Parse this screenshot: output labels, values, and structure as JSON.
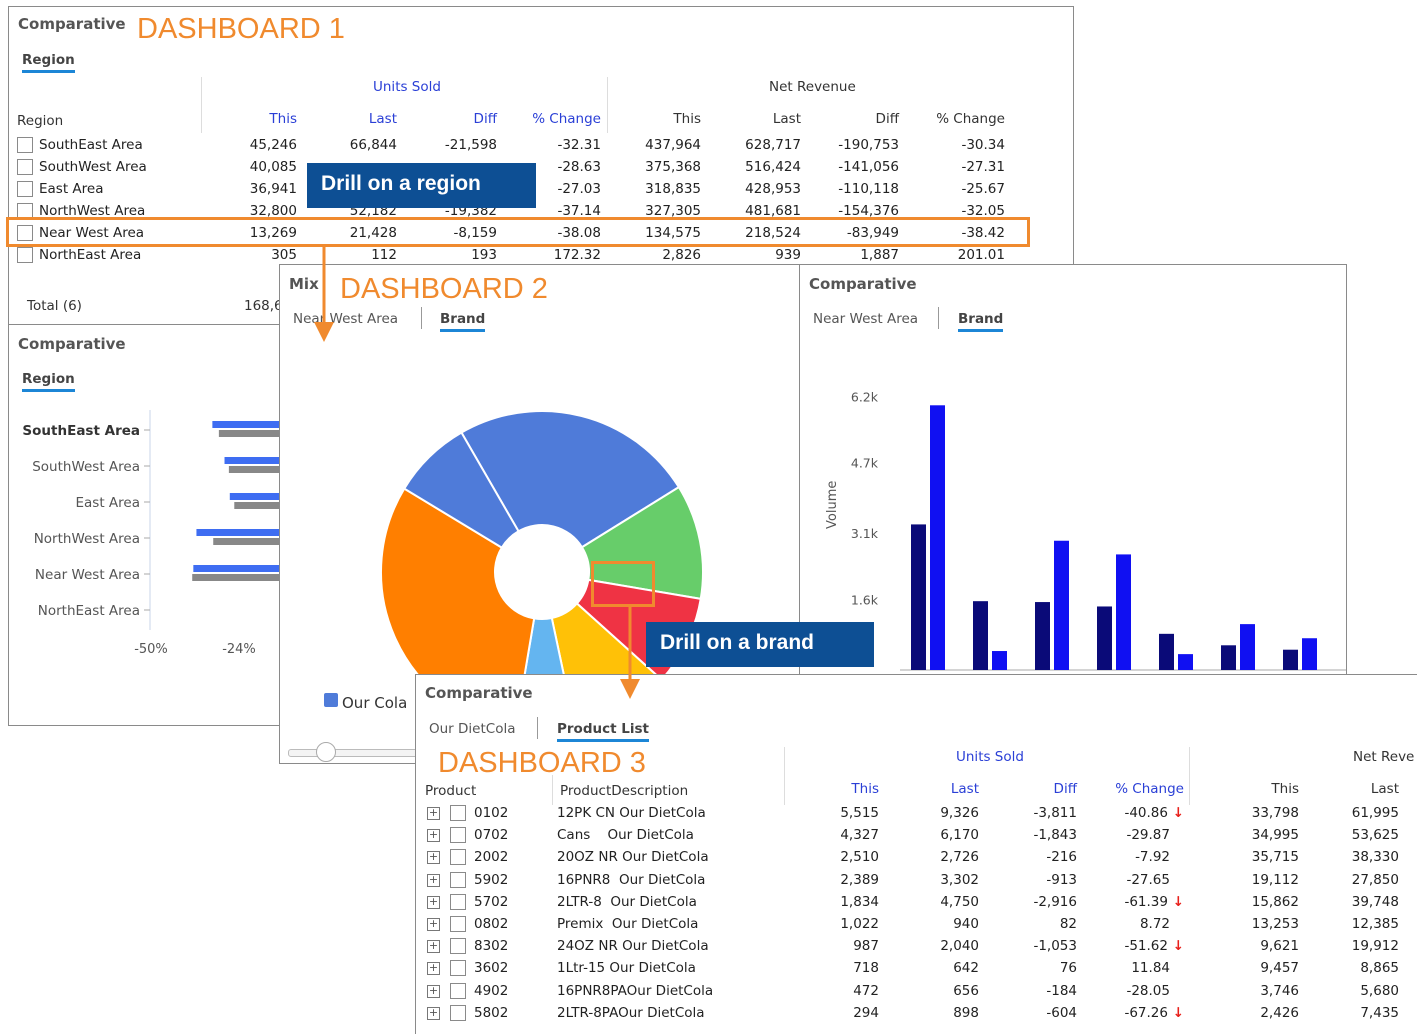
{
  "dashboard1": {
    "title": "Comparative",
    "tag": "DASHBOARD 1",
    "tab": "Region",
    "group_units": "Units Sold",
    "group_revenue": "Net Revenue",
    "col_region": "Region",
    "cols_units": [
      "This",
      "Last",
      "Diff",
      "% Change"
    ],
    "cols_revenue": [
      "This",
      "Last",
      "Diff",
      "% Change"
    ],
    "rows": [
      {
        "name": "SouthEast Area",
        "u": [
          "45,246",
          "66,844",
          "-21,598",
          "-32.31"
        ],
        "r": [
          "437,964",
          "628,717",
          "-190,753",
          "-30.34"
        ]
      },
      {
        "name": "SouthWest Area",
        "u": [
          "40,085",
          "",
          "",
          "-28.63"
        ],
        "r": [
          "375,368",
          "516,424",
          "-141,056",
          "-27.31"
        ]
      },
      {
        "name": "East Area",
        "u": [
          "36,941",
          "",
          "",
          "-27.03"
        ],
        "r": [
          "318,835",
          "428,953",
          "-110,118",
          "-25.67"
        ]
      },
      {
        "name": "NorthWest Area",
        "u": [
          "32,800",
          "52,182",
          "-19,382",
          "-37.14"
        ],
        "r": [
          "327,305",
          "481,681",
          "-154,376",
          "-32.05"
        ]
      },
      {
        "name": "Near West Area",
        "u": [
          "13,269",
          "21,428",
          "-8,159",
          "-38.08"
        ],
        "r": [
          "134,575",
          "218,524",
          "-83,949",
          "-38.42"
        ]
      },
      {
        "name": "NorthEast Area",
        "u": [
          "305",
          "112",
          "193",
          "172.32"
        ],
        "r": [
          "2,826",
          "939",
          "1,887",
          "201.01"
        ]
      }
    ],
    "total_label": "Total (6)",
    "total_value": "168,6"
  },
  "callouts": {
    "region": "Drill on a region",
    "brand": "Drill on a brand"
  },
  "comp_region_chart": {
    "title": "Comparative",
    "tab": "Region",
    "categories": [
      "SouthEast Area",
      "SouthWest Area",
      "East Area",
      "NorthWest Area",
      "Near West Area",
      "NorthEast Area"
    ],
    "ticks": [
      "-50%",
      "-24%"
    ]
  },
  "dashboard2": {
    "mix_title": "Mix",
    "tag": "DASHBOARD 2",
    "breadcrumb": "Near West Area",
    "tab": "Brand",
    "legend_label": "Our Cola"
  },
  "brand_chart": {
    "title": "Comparative",
    "breadcrumb": "Near West Area",
    "tab": "Brand",
    "ylabel": "Volume"
  },
  "chart_data": [
    {
      "type": "pie",
      "title": "",
      "labels": [
        "",
        "",
        "",
        "",
        "",
        "",
        ""
      ],
      "values": [
        24.5,
        11.5,
        9,
        10,
        6,
        31,
        8
      ],
      "colors": [
        "#4f7bd9",
        "#67cd6a",
        "#ef3344",
        "#ffc107",
        "#64b5f0",
        "#ff7f00",
        "#4f7bd9"
      ]
    },
    {
      "type": "bar",
      "title": "",
      "ylabel": "Volume",
      "yticks": [
        "1.6k",
        "3.1k",
        "4.7k",
        "6.2k"
      ],
      "ylim": [
        0,
        6800
      ],
      "categories": [
        "",
        "",
        "",
        "",
        "",
        "",
        ""
      ],
      "series": [
        {
          "values": [
            3300,
            1560,
            1540,
            1440,
            820,
            560,
            460
          ],
          "color": "#0a0a78"
        },
        {
          "values": [
            6000,
            430,
            2930,
            2620,
            360,
            1040,
            720
          ],
          "color": "#1010f2"
        }
      ]
    },
    {
      "type": "bar",
      "title": "",
      "orientation": "horizontal",
      "categories": [
        "SouthEast Area",
        "SouthWest Area",
        "East Area",
        "NorthWest Area",
        "Near West Area",
        "NorthEast Area"
      ],
      "series": [
        {
          "values": [
            -32.31,
            -28.63,
            -27.03,
            -37.14,
            -38.08,
            0
          ],
          "color": "#3e6df2"
        },
        {
          "values": [
            -30.34,
            -27.31,
            -25.67,
            -32.05,
            -38.42,
            0
          ],
          "color": "#888888"
        }
      ],
      "xticks": [
        "-50%",
        "-24%"
      ]
    }
  ],
  "dashboard3": {
    "title": "Comparative",
    "tag": "DASHBOARD 3",
    "breadcrumb": "Our DietCola",
    "tab": "Product List",
    "group_units": "Units Sold",
    "group_revenue": "Net Reve",
    "col_product": "Product",
    "col_desc": "ProductDescription",
    "cols_units": [
      "This",
      "Last",
      "Diff",
      "% Change"
    ],
    "cols_revenue": [
      "This",
      "Last"
    ],
    "rows": [
      {
        "code": "0102",
        "desc": "12PK CN Our DietCola",
        "u": [
          "5,515",
          "9,326",
          "-3,811",
          "-40.86"
        ],
        "down": true,
        "r": [
          "33,798",
          "61,995"
        ]
      },
      {
        "code": "0702",
        "desc": "Cans    Our DietCola",
        "u": [
          "4,327",
          "6,170",
          "-1,843",
          "-29.87"
        ],
        "down": false,
        "r": [
          "34,995",
          "53,625"
        ]
      },
      {
        "code": "2002",
        "desc": "20OZ NR Our DietCola",
        "u": [
          "2,510",
          "2,726",
          "-216",
          "-7.92"
        ],
        "down": false,
        "r": [
          "35,715",
          "38,330"
        ]
      },
      {
        "code": "5902",
        "desc": "16PNR8  Our DietCola",
        "u": [
          "2,389",
          "3,302",
          "-913",
          "-27.65"
        ],
        "down": false,
        "r": [
          "19,112",
          "27,850"
        ]
      },
      {
        "code": "5702",
        "desc": "2LTR-8  Our DietCola",
        "u": [
          "1,834",
          "4,750",
          "-2,916",
          "-61.39"
        ],
        "down": true,
        "r": [
          "15,862",
          "39,748"
        ]
      },
      {
        "code": "0802",
        "desc": "Premix  Our DietCola",
        "u": [
          "1,022",
          "940",
          "82",
          "8.72"
        ],
        "down": false,
        "r": [
          "13,253",
          "12,385"
        ]
      },
      {
        "code": "8302",
        "desc": "24OZ NR Our DietCola",
        "u": [
          "987",
          "2,040",
          "-1,053",
          "-51.62"
        ],
        "down": true,
        "r": [
          "9,621",
          "19,912"
        ]
      },
      {
        "code": "3602",
        "desc": "1Ltr-15 Our DietCola",
        "u": [
          "718",
          "642",
          "76",
          "11.84"
        ],
        "down": false,
        "r": [
          "9,457",
          "8,865"
        ]
      },
      {
        "code": "4902",
        "desc": "16PNR8PAOur DietCola",
        "u": [
          "472",
          "656",
          "-184",
          "-28.05"
        ],
        "down": false,
        "r": [
          "3,746",
          "5,680"
        ]
      },
      {
        "code": "5802",
        "desc": "2LTR-8PAOur DietCola",
        "u": [
          "294",
          "898",
          "-604",
          "-67.26"
        ],
        "down": true,
        "r": [
          "2,426",
          "7,435"
        ]
      }
    ]
  }
}
